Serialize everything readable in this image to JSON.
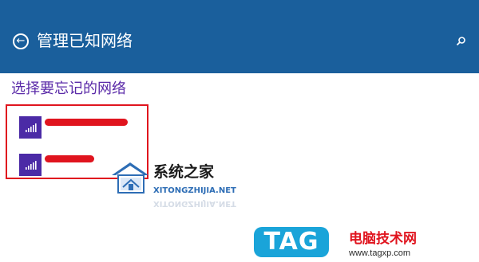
{
  "header": {
    "title": "管理已知网络",
    "background": "#1a5f9c",
    "back_icon": "back-arrow-icon",
    "search_icon": "search-icon"
  },
  "section": {
    "title": "选择要忘记的网络",
    "title_color": "#5a2aa8"
  },
  "networks": [
    {
      "name": "",
      "icon": "wifi-signal-icon",
      "redacted": true
    },
    {
      "name": "",
      "icon": "wifi-signal-icon",
      "redacted": true
    }
  ],
  "colors": {
    "tile": "#4b2aa6",
    "highlight": "#e0141e",
    "redaction": "#e0141e"
  },
  "watermark": {
    "site_name": "系统之家",
    "url": "XITONGZHIJIA.NET"
  },
  "tag_watermark": {
    "badge": "TAG",
    "name": "电脑技术网",
    "url": "www.tagxp.com"
  }
}
